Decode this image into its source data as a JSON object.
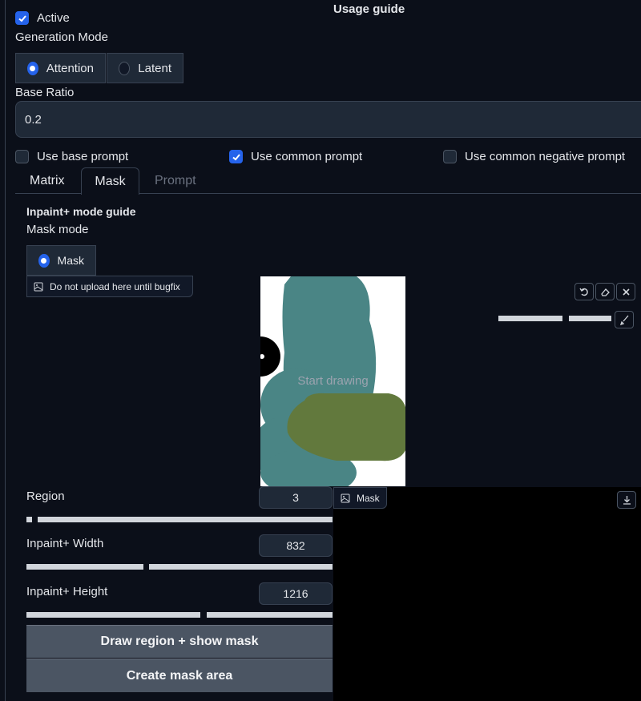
{
  "header": {
    "usage_guide": "Usage guide"
  },
  "active": {
    "label": "Active",
    "checked": true
  },
  "generation_mode": {
    "label": "Generation Mode",
    "options": [
      "Attention",
      "Latent"
    ],
    "selected": "Attention"
  },
  "base_ratio": {
    "label": "Base Ratio",
    "value": "0.2"
  },
  "prompt_options": {
    "use_base_prompt": {
      "label": "Use base prompt",
      "checked": false
    },
    "use_common_prompt": {
      "label": "Use common prompt",
      "checked": true
    },
    "use_common_negative_prompt": {
      "label": "Use common negative prompt",
      "checked": false
    }
  },
  "tabs": [
    "Matrix",
    "Mask",
    "Prompt"
  ],
  "active_tab": "Mask",
  "mask_panel": {
    "guide_title": "Inpaint+ mode guide",
    "mask_mode_label": "Mask mode",
    "mask_mode_option": "Mask",
    "upload_label": "Do not upload here until bugfix",
    "canvas_placeholder": "Start drawing"
  },
  "region": {
    "label": "Region",
    "value": "3"
  },
  "inpaint_width": {
    "label": "Inpaint+ Width",
    "value": "832"
  },
  "inpaint_height": {
    "label": "Inpaint+ Height",
    "value": "1216"
  },
  "output_label": "Mask",
  "buttons": {
    "draw_region": "Draw region + show mask",
    "create_mask": "Create mask area"
  },
  "colors": {
    "accent": "#2563eb",
    "teal_stroke": "#4a8585",
    "green_stroke": "#62793d",
    "background": "#0b0f19"
  }
}
